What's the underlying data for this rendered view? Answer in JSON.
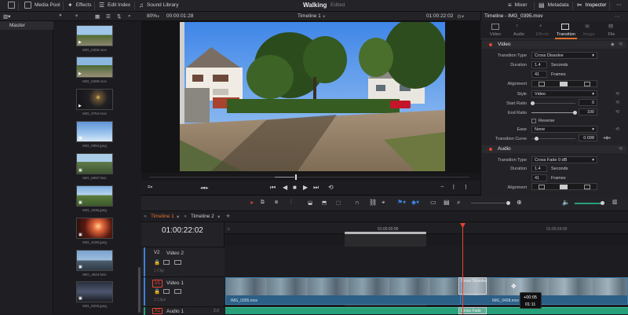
{
  "app": {
    "project_name": "Walking",
    "project_status": "Edited",
    "top_left": [
      {
        "icon": "media-pool-icon",
        "label": "Media Pool"
      },
      {
        "icon": "effects-icon",
        "label": "Effects"
      },
      {
        "icon": "edit-index-icon",
        "label": "Edit Index"
      },
      {
        "icon": "sound-library-icon",
        "label": "Sound Library"
      }
    ],
    "top_right": [
      {
        "icon": "mixer-icon",
        "label": "Mixer"
      },
      {
        "icon": "metadata-icon",
        "label": "Metadata"
      },
      {
        "icon": "inspector-icon",
        "label": "Inspector"
      }
    ]
  },
  "viewer": {
    "zoom": "80%",
    "source_timecode": "00:00:01:28",
    "timeline_name": "Timeline 1",
    "record_timecode": "01:00:22:02"
  },
  "media_pool": {
    "bin": "Master",
    "clips": [
      {
        "name": "IMG_0406.mov",
        "type": "video"
      },
      {
        "name": "IMG_0408.mov",
        "type": "video"
      },
      {
        "name": "IMG_0764.mov",
        "type": "video"
      },
      {
        "name": "IMG_0994.jpeg",
        "type": "image"
      },
      {
        "name": "IMG_5997.heic",
        "type": "image"
      },
      {
        "name": "IMG_1936.jpeg",
        "type": "image"
      },
      {
        "name": "IMG_4180.jpeg",
        "type": "image"
      },
      {
        "name": "IMG_4624.heic",
        "type": "image"
      },
      {
        "name": "IMG_8200.jpeg",
        "type": "image"
      }
    ]
  },
  "inspector": {
    "title": "Timeline - IMG_0395.mov",
    "tabs": [
      "Video",
      "Audio",
      "Effects",
      "Transition",
      "Image",
      "File"
    ],
    "active_tab": "Transition",
    "video": {
      "section": "Video",
      "transition_type_label": "Transition Type",
      "transition_type": "Cross Dissolve",
      "duration_label": "Duration",
      "duration_seconds": "1.4",
      "seconds_label": "Seconds",
      "duration_frames": "41",
      "frames_label": "Frames",
      "alignment_label": "Alignment",
      "style_label": "Style",
      "style": "Video",
      "start_ratio_label": "Start Ratio",
      "start_ratio": "0",
      "end_ratio_label": "End Ratio",
      "end_ratio": "100",
      "reverse_label": "Reverse",
      "ease_label": "Ease",
      "ease": "None",
      "curve_label": "Transition Curve",
      "curve": "0.098"
    },
    "audio": {
      "section": "Audio",
      "transition_type_label": "Transition Type",
      "transition_type": "Cross Fade 0 dB",
      "duration_label": "Duration",
      "duration_seconds": "1.4",
      "seconds_label": "Seconds",
      "duration_frames": "41",
      "frames_label": "Frames",
      "alignment_label": "Alignment"
    }
  },
  "timeline": {
    "tabs": [
      "Timeline 1",
      "Timeline 2"
    ],
    "timecode": "01:00:22:02",
    "ruler_marks": [
      "01:00:20:00",
      "01:00:24:00"
    ],
    "tracks": [
      {
        "id": "V2",
        "name": "Video 2",
        "clips": "1 Clip"
      },
      {
        "id": "V1",
        "name": "Video 1",
        "clips": "3 Clips"
      },
      {
        "id": "A1",
        "name": "Audio 1",
        "level": "2.0"
      }
    ],
    "clip_names": [
      "IMG_0395.mov",
      "IMG_0408.mov"
    ],
    "transition_labels": [
      "Cross Dissolve",
      "Cross Fade"
    ],
    "drag_tooltip": [
      "+00:05",
      "01:11"
    ]
  },
  "colors": {
    "accent_orange": "#e0702e",
    "playhead": "#e8432f",
    "video_clip": "#2c5f86",
    "audio_clip": "#27a07a",
    "panel": "#232327"
  }
}
